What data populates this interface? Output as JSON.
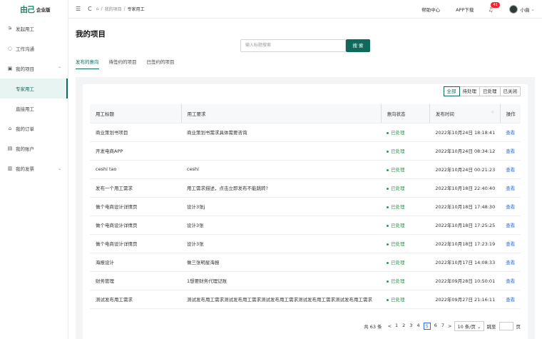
{
  "brand": {
    "mark": "由己",
    "text": "企业版"
  },
  "sidebar": {
    "items": [
      {
        "label": "发起用工",
        "icon": "send-icon",
        "glyph": "⚞"
      },
      {
        "label": "工作沟通",
        "icon": "chat-icon",
        "glyph": "◌"
      },
      {
        "label": "我的项目",
        "icon": "project-icon",
        "glyph": "▣",
        "expanded": true,
        "children": [
          {
            "label": "专家用工",
            "active": true
          },
          {
            "label": "直接用工"
          }
        ]
      },
      {
        "label": "我的订单",
        "icon": "order-icon",
        "glyph": "⌂"
      },
      {
        "label": "我的账户",
        "icon": "account-icon",
        "glyph": "▤"
      },
      {
        "label": "我的发票",
        "icon": "invoice-icon",
        "glyph": "▥",
        "chevron": "⌄"
      }
    ]
  },
  "topbar": {
    "menu_glyph": "☰",
    "refresh_glyph": "C",
    "home_glyph": "⌂",
    "breadcrumb": [
      "我的项目",
      "专家用工"
    ],
    "help": "帮助中心",
    "app": "APP下载",
    "bell_glyph": "♫",
    "notify_count": "41",
    "user": "小曲"
  },
  "page": {
    "title": "我的项目",
    "search_placeholder": "输入标题搜索",
    "search_button": "搜 索",
    "tabs": [
      "发布的意向",
      "待签约的项目",
      "已签约的项目"
    ]
  },
  "filters": [
    "全部",
    "待处理",
    "已处理",
    "已关闭"
  ],
  "table": {
    "headers": [
      "用工标题",
      "用工要求",
      "意向状态",
      "发布时间",
      "操作"
    ],
    "rows": [
      [
        "商业策划书项目",
        "商业策划书需求具体需要咨询",
        "已处理",
        "2022年10月24日 18:18:41",
        "查看"
      ],
      [
        "开发电商APP",
        "",
        "已处理",
        "2022年10月24日 08:34:12",
        "查看"
      ],
      [
        "ceshi tao",
        "ceshi",
        "已处理",
        "2022年10月24日 00:21:23",
        "查看"
      ],
      [
        "发布一个用工需求",
        "用工需求描述，点击立即发布不能跳转?",
        "已处理",
        "2022年10月18日 22:40:40",
        "查看"
      ],
      [
        "做个电商设计详情页",
        "设计3张j",
        "已处理",
        "2022年10月18日 17:48:30",
        "查看"
      ],
      [
        "做个电商设计详情页",
        "设计3张",
        "已处理",
        "2022年10月18日 17:25:25",
        "查看"
      ],
      [
        "做个电商设计详情页",
        "设计3张",
        "已处理",
        "2022年10月18日 17:23:19",
        "查看"
      ],
      [
        "海报设计",
        "做三张明星海报",
        "已处理",
        "2022年10月17日 14:08:33",
        "查看"
      ],
      [
        "财务管理",
        "1想要财务代理记账",
        "已处理",
        "2022年09月28日 10:50:01",
        "查看"
      ],
      [
        "测试发布用工需求",
        "测试发布用工需求测试发布用工需求测试发布用工需求测试发布用工需求测试发布用工需求",
        "已处理",
        "2022年09月27日 21:16:11",
        "查看"
      ]
    ]
  },
  "pagination": {
    "total": "共 63 条",
    "prev": "<",
    "next": ">",
    "pages": [
      "1",
      "2",
      "3",
      "4",
      "5",
      "6",
      "7"
    ],
    "current": "5",
    "page_size": "10 条/页 ⌄",
    "goto_label": "跳至",
    "page_suffix": "页"
  },
  "colors": {
    "primary": "#0f6a5c",
    "link": "#2f6fd6",
    "status": "#2a9d4b",
    "badge": "#f5222d"
  }
}
